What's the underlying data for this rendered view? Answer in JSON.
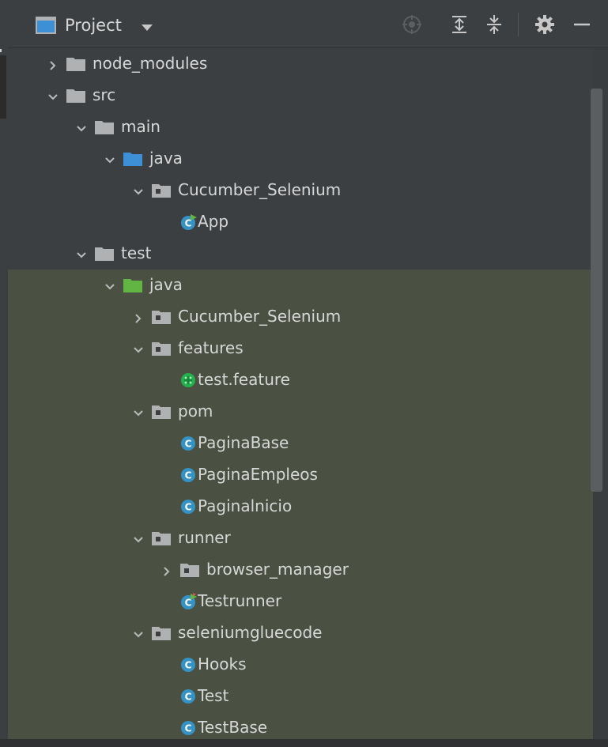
{
  "header": {
    "title": "Project",
    "actions": [
      "locate-icon",
      "expand-all-icon",
      "collapse-all-icon",
      "gear-icon",
      "hide-icon"
    ]
  },
  "colors": {
    "background": "#3c3f41",
    "highlight": "#4a5142",
    "folder": "#afb1b3",
    "source_root": "#3d8fd6",
    "test_root": "#62b543",
    "class_badge": "#3592c4"
  },
  "tree": [
    {
      "label": "node_modules",
      "icon": "folder-icon",
      "arrow": "right"
    },
    {
      "label": "src",
      "icon": "folder-icon",
      "arrow": "down"
    },
    {
      "label": "main",
      "icon": "folder-icon",
      "arrow": "down"
    },
    {
      "label": "java",
      "icon": "source-folder-icon",
      "arrow": "down"
    },
    {
      "label": "Cucumber_Selenium",
      "icon": "package-icon",
      "arrow": "down"
    },
    {
      "label": "App",
      "icon": "runnable-class-icon",
      "arrow": "none"
    },
    {
      "label": "test",
      "icon": "folder-icon",
      "arrow": "down"
    },
    {
      "label": "java",
      "icon": "test-source-folder-icon",
      "arrow": "down"
    },
    {
      "label": "Cucumber_Selenium",
      "icon": "package-icon",
      "arrow": "right"
    },
    {
      "label": "features",
      "icon": "package-icon",
      "arrow": "down"
    },
    {
      "label": "test.feature",
      "icon": "feature-file-icon",
      "arrow": "none"
    },
    {
      "label": "pom",
      "icon": "package-icon",
      "arrow": "down"
    },
    {
      "label": "PaginaBase",
      "icon": "class-icon",
      "arrow": "none"
    },
    {
      "label": "PaginaEmpleos",
      "icon": "class-icon",
      "arrow": "none"
    },
    {
      "label": "Paginalnicio",
      "icon": "class-icon",
      "arrow": "none"
    },
    {
      "label": "runner",
      "icon": "package-icon",
      "arrow": "down"
    },
    {
      "label": "browser_manager",
      "icon": "package-icon",
      "arrow": "right"
    },
    {
      "label": "Testrunner",
      "icon": "test-class-icon",
      "arrow": "none"
    },
    {
      "label": "seleniumgluecode",
      "icon": "package-icon",
      "arrow": "down"
    },
    {
      "label": "Hooks",
      "icon": "class-icon",
      "arrow": "none"
    },
    {
      "label": "Test",
      "icon": "class-icon",
      "arrow": "none"
    },
    {
      "label": "TestBase",
      "icon": "class-icon",
      "arrow": "none"
    }
  ]
}
